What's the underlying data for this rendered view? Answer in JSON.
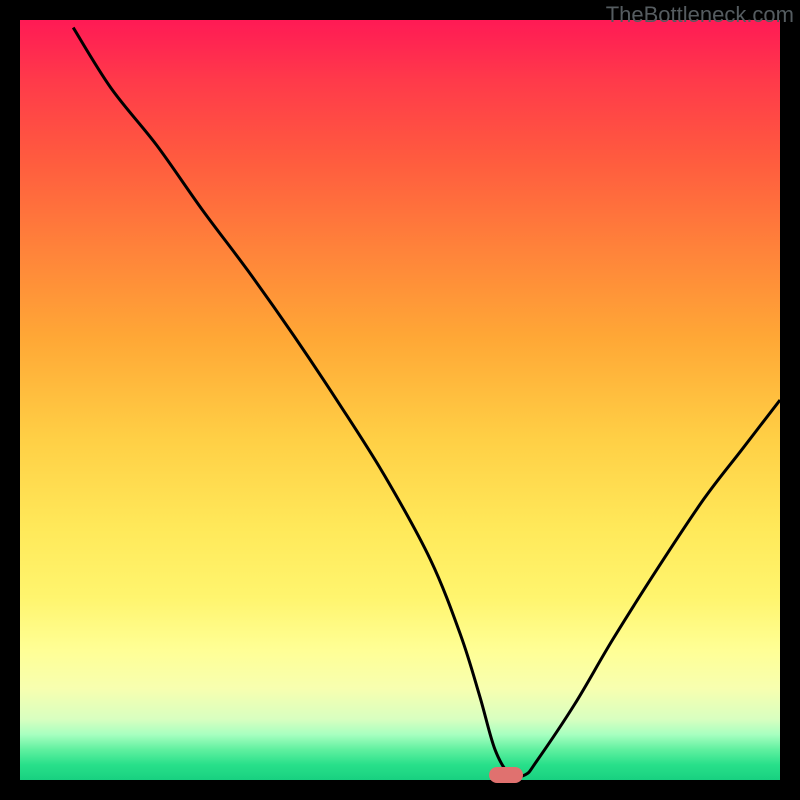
{
  "watermark": "TheBottleneck.com",
  "chart_data": {
    "type": "line",
    "title": "",
    "xlabel": "",
    "ylabel": "",
    "xlim": [
      0,
      100
    ],
    "ylim": [
      0,
      100
    ],
    "grid": false,
    "legend": false,
    "note": "Values read as percentage of inner plot area; V-shaped bottleneck curve",
    "series": [
      {
        "name": "curve",
        "color": "#000000",
        "x": [
          7,
          12,
          18,
          24,
          30,
          36,
          42,
          48,
          54,
          58,
          60.5,
          62.5,
          64.5,
          66.5,
          68,
          73,
          78,
          84,
          90,
          95,
          100
        ],
        "values": [
          99,
          91,
          83.5,
          75,
          67,
          58.5,
          49.5,
          40,
          29,
          19,
          11,
          4,
          0.7,
          0.7,
          2.5,
          10,
          18.5,
          28,
          37,
          43.5,
          50
        ]
      }
    ],
    "marker": {
      "x": 64,
      "y": 0.7,
      "color": "#e0716f"
    }
  }
}
